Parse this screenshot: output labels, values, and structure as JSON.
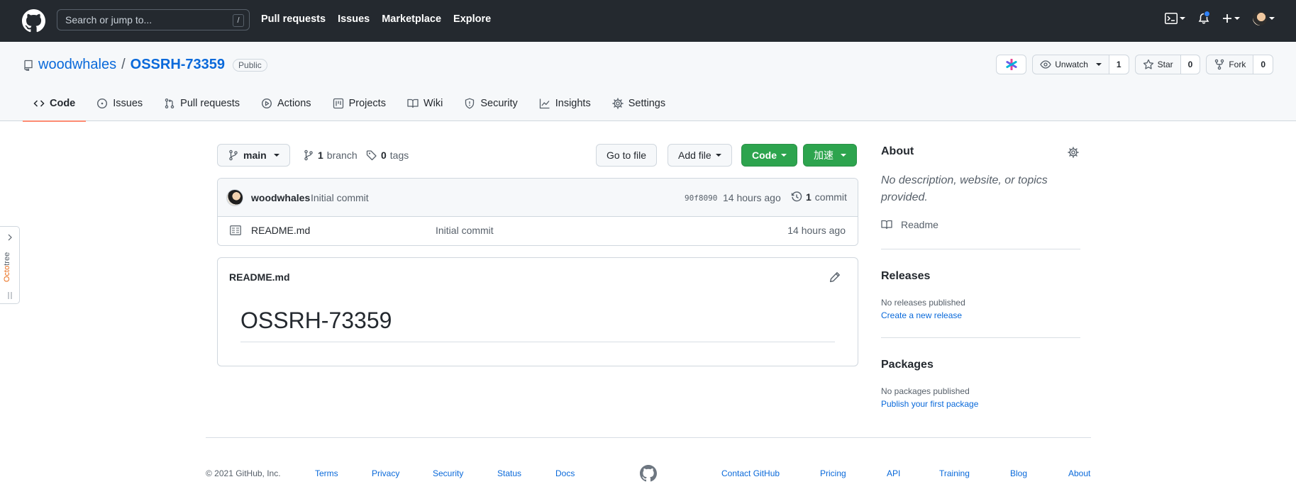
{
  "header": {
    "search_placeholder": "Search or jump to...",
    "search_shortcut": "/",
    "nav": [
      "Pull requests",
      "Issues",
      "Marketplace",
      "Explore"
    ],
    "icons": [
      "github-logo-icon",
      "terminal-icon",
      "bell-icon",
      "plus-icon",
      "avatar"
    ],
    "notification_color": "#2f81f7"
  },
  "repo": {
    "owner": "woodwhales",
    "separator": "/",
    "name": "OSSRH-73359",
    "visibility": "Public",
    "watch_label": "Unwatch",
    "watch_count": "1",
    "star_label": "Star",
    "star_count": "0",
    "fork_label": "Fork",
    "fork_count": "0"
  },
  "tabs": [
    {
      "label": "Code",
      "icon": "code-icon",
      "selected": true
    },
    {
      "label": "Issues",
      "icon": "issue-opened-icon"
    },
    {
      "label": "Pull requests",
      "icon": "git-pull-request-icon"
    },
    {
      "label": "Actions",
      "icon": "play-icon"
    },
    {
      "label": "Projects",
      "icon": "project-icon"
    },
    {
      "label": "Wiki",
      "icon": "book-icon"
    },
    {
      "label": "Security",
      "icon": "shield-icon"
    },
    {
      "label": "Insights",
      "icon": "graph-icon"
    },
    {
      "label": "Settings",
      "icon": "gear-icon"
    }
  ],
  "octotree": {
    "label_prefix": "Octo",
    "label_suffix": "tree"
  },
  "filenav": {
    "branch": "main",
    "branch_count": "1",
    "branch_word": "branch",
    "tag_count": "0",
    "tag_word": "tags",
    "go_to_file": "Go to file",
    "add_file": "Add file",
    "code": "Code",
    "accelerate": "加速"
  },
  "commit": {
    "author": "woodwhales",
    "message": "Initial commit",
    "sha": "90f8090",
    "time": "14 hours ago",
    "count": "1",
    "count_word": "commit"
  },
  "files": [
    {
      "name": "README.md",
      "message": "Initial commit",
      "time": "14 hours ago"
    }
  ],
  "readme": {
    "file_name": "README.md",
    "heading": "OSSRH-73359"
  },
  "sidebar": {
    "about_title": "About",
    "about_desc": "No description, website, or topics provided.",
    "readme_link": "Readme",
    "releases_title": "Releases",
    "releases_empty": "No releases published",
    "releases_link": "Create a new release",
    "packages_title": "Packages",
    "packages_empty": "No packages published",
    "packages_link": "Publish your first package"
  },
  "footer": {
    "copyright": "© 2021 GitHub, Inc.",
    "left_links": [
      "Terms",
      "Privacy",
      "Security",
      "Status",
      "Docs"
    ],
    "right_links": [
      "Contact GitHub",
      "Pricing",
      "API",
      "Training",
      "Blog",
      "About"
    ]
  },
  "colors": {
    "header_bg": "#24292f",
    "link": "#0969da",
    "green_button": "#2da44e",
    "selected_tab_underline": "#fd8c73",
    "octotree_accent": "#e96a16"
  }
}
